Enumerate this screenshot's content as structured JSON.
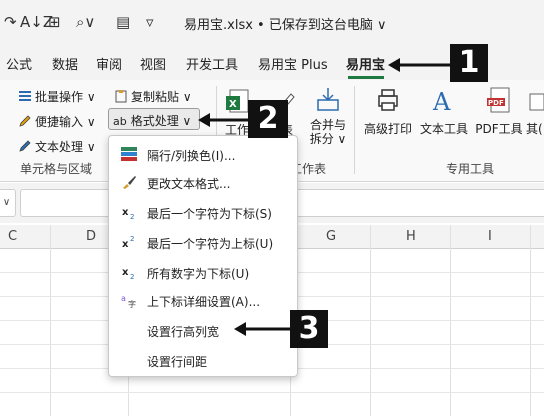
{
  "title_bar": {
    "sort_icon": "sort-az-icon",
    "doc_title": "易用宝.xlsx • 已保存到这台电脑 ∨"
  },
  "tabs": [
    "公式",
    "数据",
    "审阅",
    "视图",
    "开发工具",
    "易用宝 Plus",
    "易用宝"
  ],
  "active_tab": "易用宝",
  "ribbon": {
    "batch_ops": "批量操作 ∨",
    "quick_input": "便捷输入 ∨",
    "text_proc": "文本处理 ∨",
    "copy_paste": "复制粘贴 ∨",
    "format_proc": "格式处理 ∨",
    "group_cells": "单元格与区域",
    "worksheet_label": "工作",
    "table_label": "表",
    "merge_split": "合并与",
    "merge_split2": "拆分 ∨",
    "group_worksheet": "工作表",
    "adv_print": "高级打印",
    "text_tools": "文本工具",
    "pdf_tools": "PDF工具",
    "other": "其(",
    "group_special": "专用工具"
  },
  "columns": [
    "C",
    "D",
    "G",
    "H",
    "I"
  ],
  "menu": [
    {
      "label": "隔行/列换色(I)...",
      "icon": "color-stripes-icon"
    },
    {
      "label": "更改文本格式...",
      "icon": "paintbrush-icon"
    },
    {
      "label": "最后一个字符为下标(S)",
      "icon": "subscript-icon"
    },
    {
      "label": "最后一个字符为上标(U)",
      "icon": "superscript-icon"
    },
    {
      "label": "所有数字为下标(U)",
      "icon": "subscript-icon"
    },
    {
      "label": "上下标详细设置(A)...",
      "icon": "sub-super-settings-icon"
    },
    {
      "label": "设置行高列宽",
      "icon": ""
    },
    {
      "label": "设置行间距",
      "icon": ""
    }
  ],
  "callouts": [
    "1",
    "2",
    "3"
  ],
  "colors": {
    "accent_green": "#1e7a3e",
    "badge": "#111111"
  }
}
